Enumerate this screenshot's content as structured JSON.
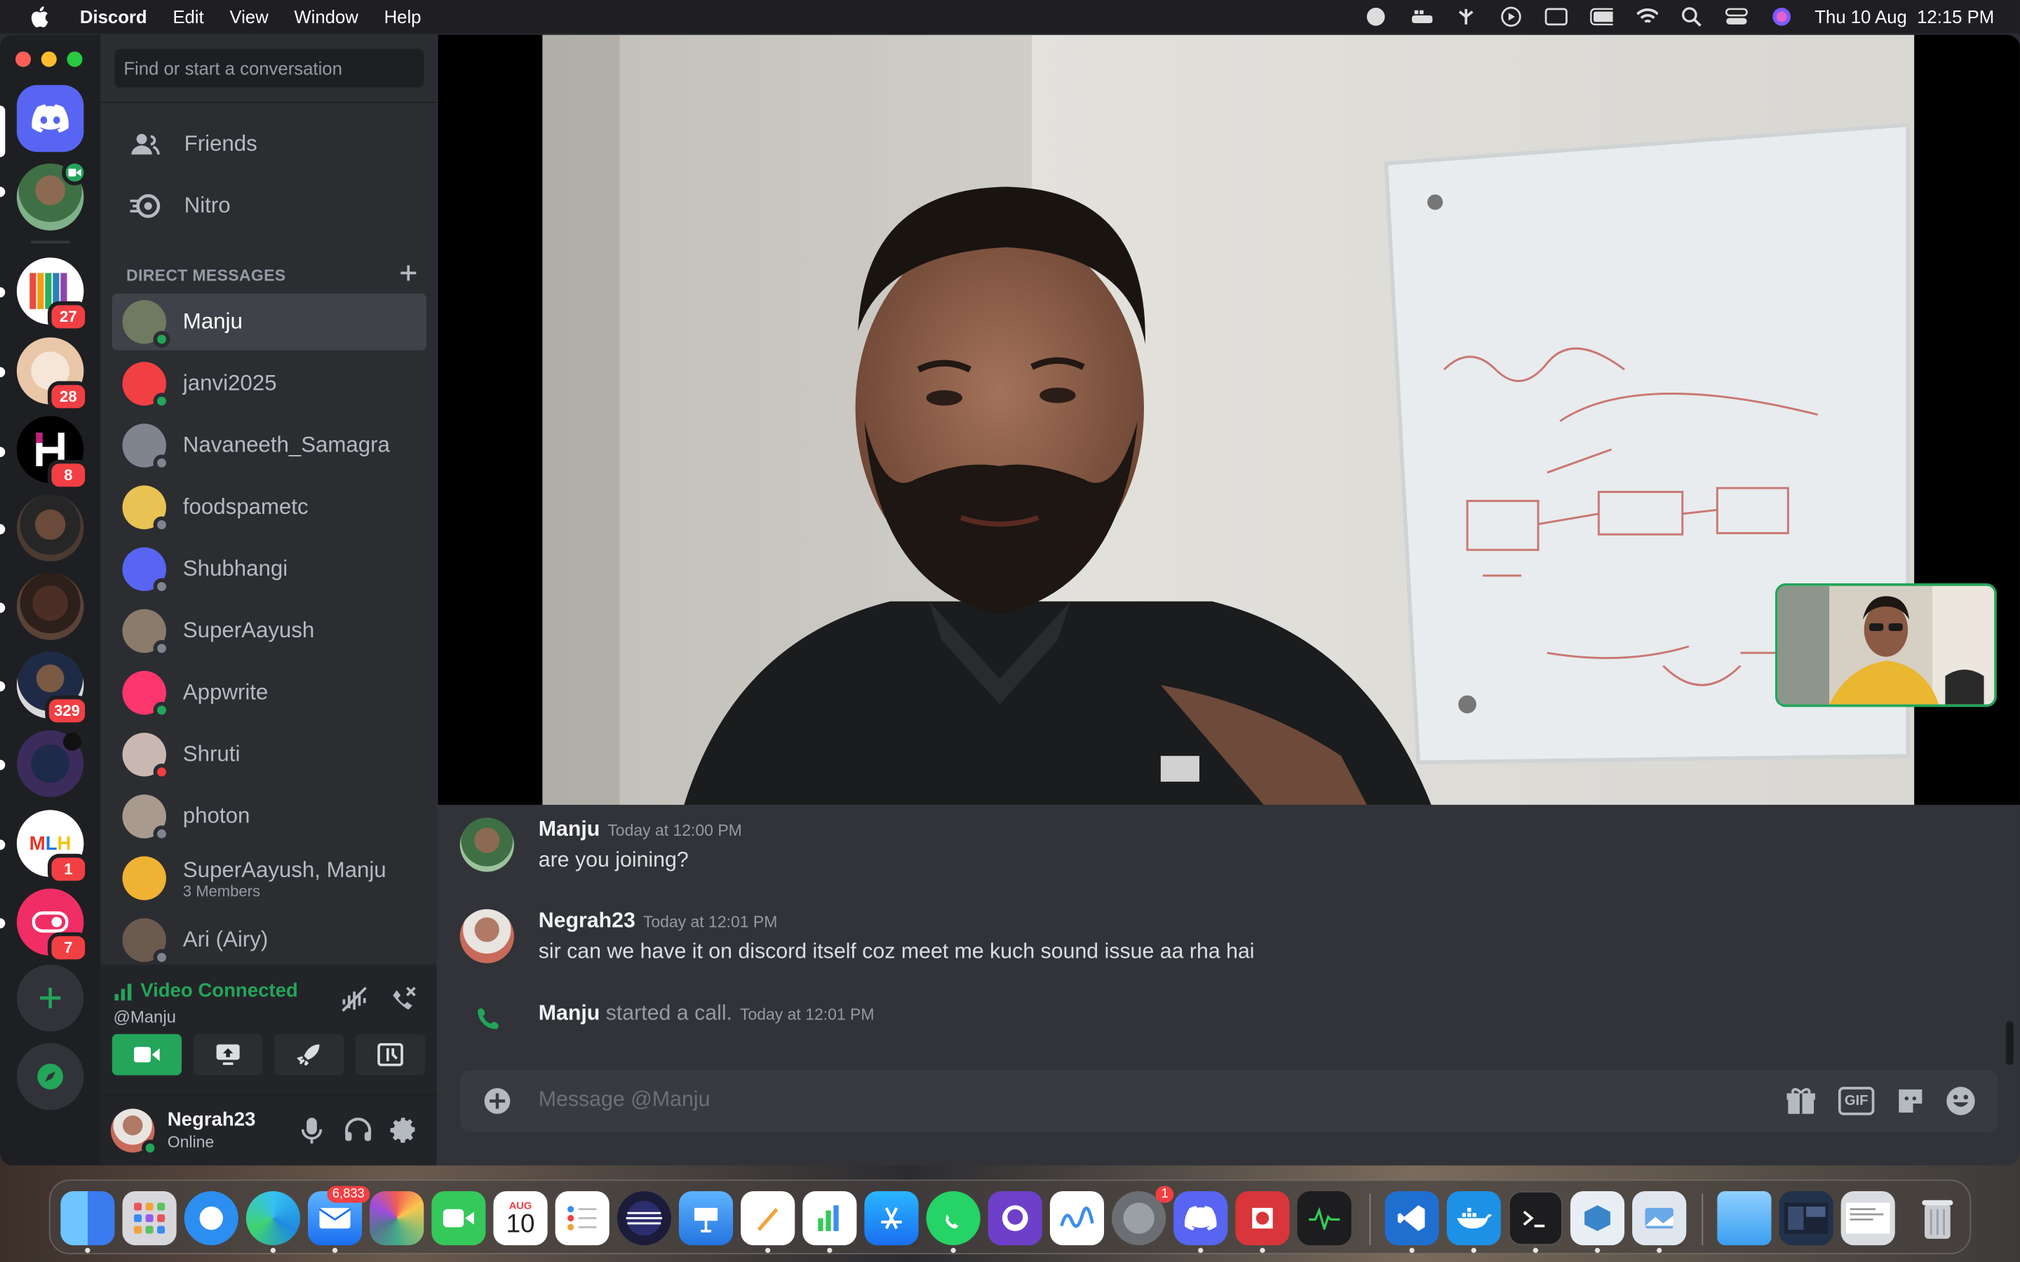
{
  "menubar": {
    "app": "Discord",
    "items": [
      "Edit",
      "View",
      "Window",
      "Help"
    ],
    "datetime": "Thu 10 Aug  12:15 PM"
  },
  "sidebar": {
    "search_placeholder": "Find or start a conversation",
    "nav": [
      {
        "label": "Friends",
        "icon": "friends-icon"
      },
      {
        "label": "Nitro",
        "icon": "nitro-icon"
      }
    ],
    "dm_header": "DIRECT MESSAGES",
    "dms": [
      {
        "name": "Manju",
        "status": "online",
        "active": true,
        "avatar_color": "#6f7a61"
      },
      {
        "name": "janvi2025",
        "status": "online",
        "avatar_color": "#f23f43"
      },
      {
        "name": "Navaneeth_Samagra",
        "status": "offline",
        "avatar_color": "#80848e"
      },
      {
        "name": "foodspametc",
        "status": "offline",
        "avatar_color": "#e8c252"
      },
      {
        "name": "Shubhangi",
        "status": "offline",
        "avatar_color": "#5865f2"
      },
      {
        "name": "SuperAayush",
        "status": "offline",
        "avatar_color": "#8a7b6b"
      },
      {
        "name": "Appwrite",
        "status": "online",
        "avatar_color": "#fd366e"
      },
      {
        "name": "Shruti",
        "status": "dnd",
        "avatar_color": "#c9b8b2"
      },
      {
        "name": "photon",
        "status": "offline",
        "avatar_color": "#a89a8f"
      },
      {
        "name": "SuperAayush, Manju",
        "subtitle": "3 Members",
        "status": "none",
        "avatar_color": "#f0b232"
      },
      {
        "name": "Ari (Airy)",
        "status": "offline",
        "avatar_color": "#6b5a4e"
      }
    ],
    "voice": {
      "status": "Video Connected",
      "channel": "@Manju"
    },
    "user": {
      "name": "Negrah23",
      "status": "Online"
    }
  },
  "servers": [
    {
      "name": "discord-home",
      "badge": ""
    },
    {
      "name": "dm-call",
      "badge": ""
    },
    {
      "name": "server-colors",
      "badge": "27"
    },
    {
      "name": "server-code",
      "badge": "28"
    },
    {
      "name": "server-h",
      "badge": "8"
    },
    {
      "name": "server-avatar1",
      "badge": ""
    },
    {
      "name": "server-avatar2",
      "badge": ""
    },
    {
      "name": "server-avatar3",
      "badge": "329"
    },
    {
      "name": "server-globe",
      "badge": ""
    },
    {
      "name": "server-mlh",
      "badge": "1"
    },
    {
      "name": "server-appwrite",
      "badge": "7"
    }
  ],
  "chat": {
    "messages": [
      {
        "author": "Manju",
        "time": "Today at 12:00 PM",
        "text": "are you joining?"
      },
      {
        "author": "Negrah23",
        "time": "Today at 12:01 PM",
        "text": "sir can we have it on discord itself coz meet me kuch sound issue aa rha hai"
      }
    ],
    "system": {
      "author": "Manju",
      "action": "started a call.",
      "time": "Today at 12:01 PM"
    },
    "composer_placeholder": "Message @Manju",
    "gif_label": "GIF"
  },
  "dock": {
    "mail_badge": "6,833",
    "calendar_month": "AUG",
    "calendar_day": "10",
    "settings_badge": "1"
  },
  "colors": {
    "accent": "#5865f2",
    "online": "#23a55a",
    "danger": "#f23f43",
    "bg": "#313338",
    "sidebar": "#2b2d31",
    "rail": "#1e1f22"
  }
}
